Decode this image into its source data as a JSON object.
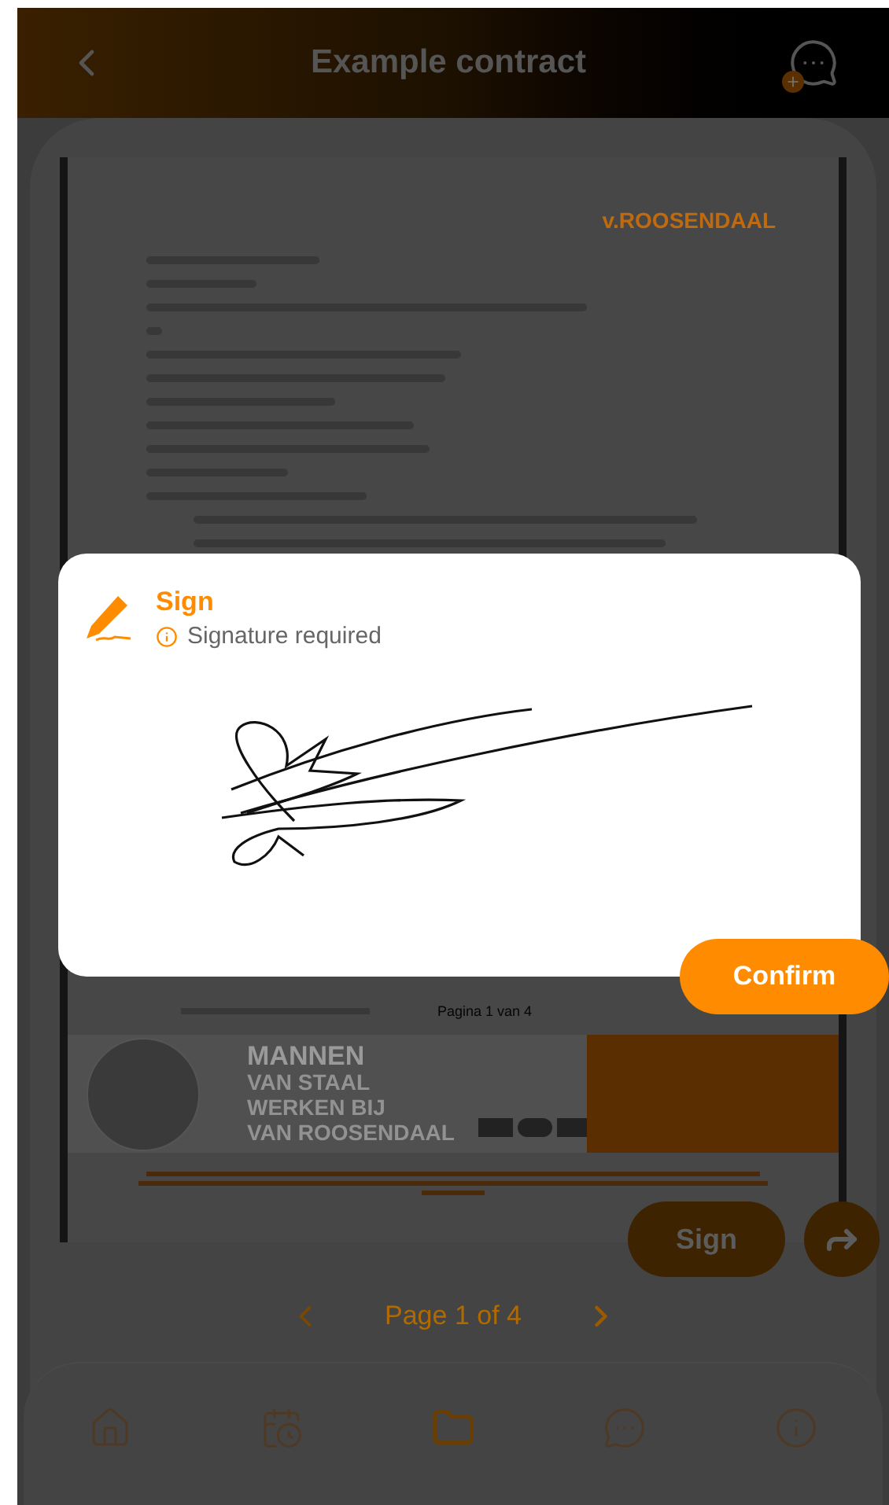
{
  "header": {
    "title": "Example contract"
  },
  "document": {
    "logo": "v.ROOSENDAAL",
    "banner_lines": [
      "MANNEN",
      "VAN STAAL",
      "WERKEN BIJ",
      "VAN ROOSENDAAL"
    ],
    "page_footer": "Pagina 1 van 4"
  },
  "sign_button": "Sign",
  "pagination": {
    "label": "Page 1 of 4"
  },
  "nav": [
    {
      "kind": "home",
      "selected": false
    },
    {
      "kind": "calendar",
      "selected": false
    },
    {
      "kind": "folder",
      "selected": true
    },
    {
      "kind": "chat",
      "selected": false
    },
    {
      "kind": "info",
      "selected": false
    }
  ],
  "dialog": {
    "title": "Sign",
    "hint": "Signature required",
    "confirm": "Confirm"
  }
}
